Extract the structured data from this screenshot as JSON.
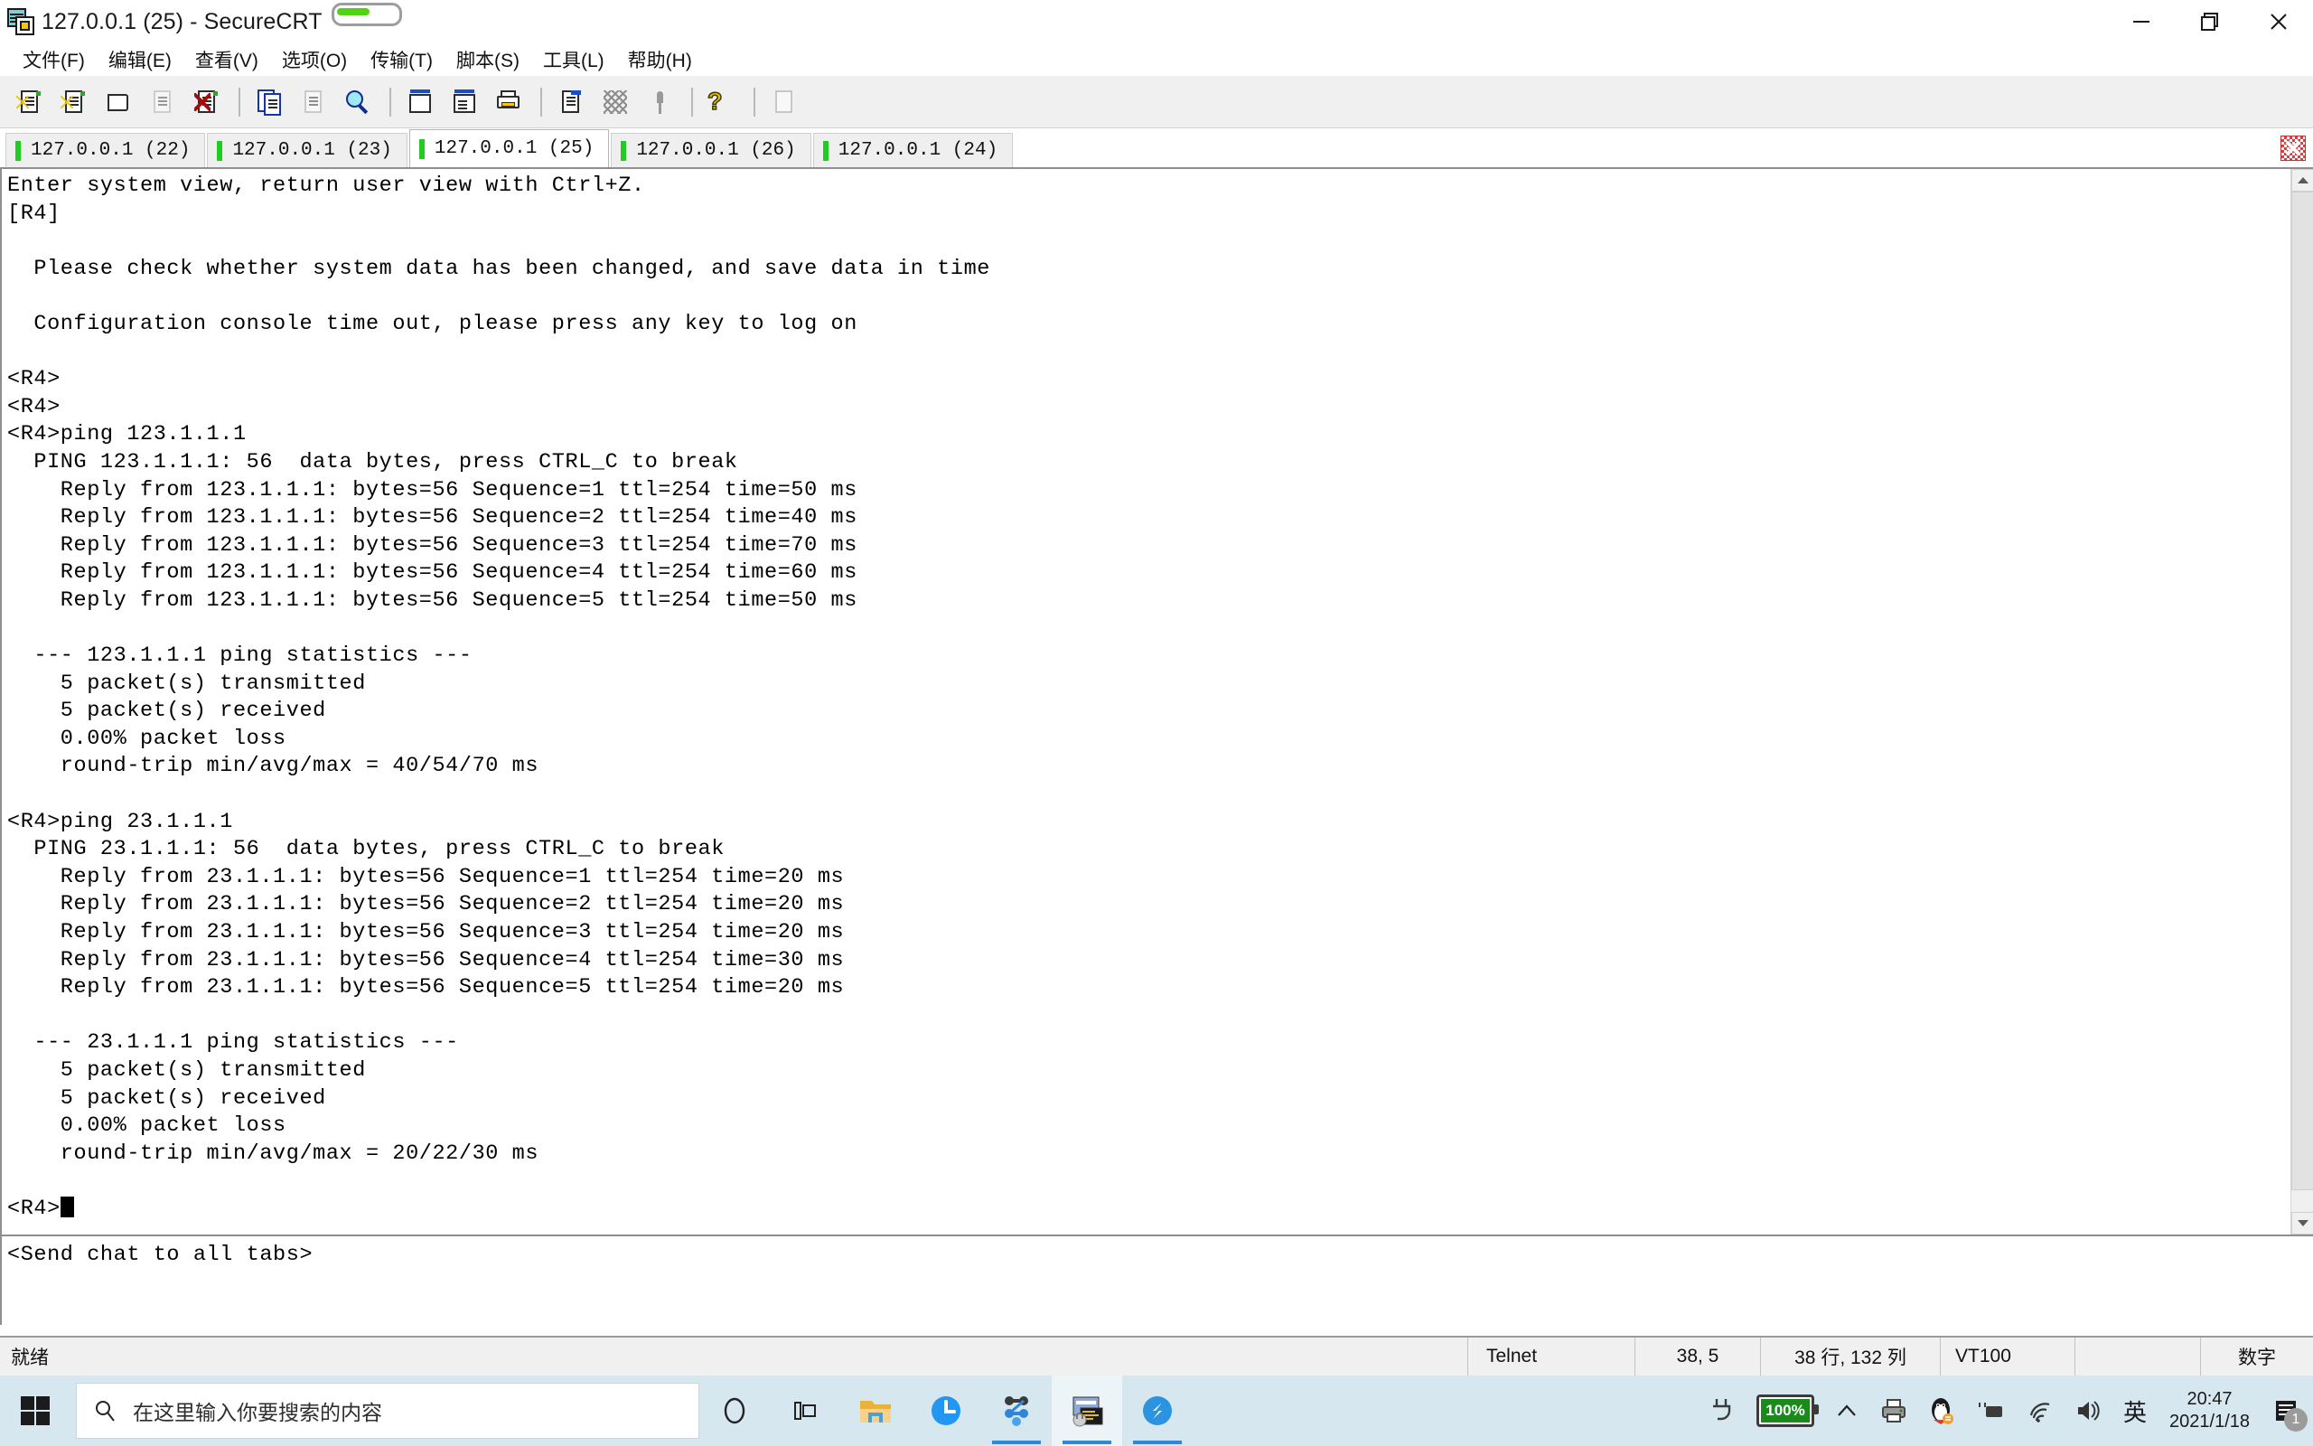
{
  "window": {
    "title": "127.0.0.1 (25) - SecureCRT",
    "icon": "securecrt-icon",
    "minimize_label": "—",
    "maximize_label": "restore",
    "close_label": "✕"
  },
  "menu": {
    "items": [
      {
        "label": "文件(F)",
        "name": "menu-file"
      },
      {
        "label": "编辑(E)",
        "name": "menu-edit"
      },
      {
        "label": "查看(V)",
        "name": "menu-view"
      },
      {
        "label": "选项(O)",
        "name": "menu-options"
      },
      {
        "label": "传输(T)",
        "name": "menu-transfer"
      },
      {
        "label": "脚本(S)",
        "name": "menu-script"
      },
      {
        "label": "工具(L)",
        "name": "menu-tools"
      },
      {
        "label": "帮助(H)",
        "name": "menu-help"
      }
    ]
  },
  "toolbar": {
    "buttons": [
      {
        "name": "new-session-icon"
      },
      {
        "name": "quick-connect-icon"
      },
      {
        "name": "open-session-icon"
      },
      {
        "name": "connect-sftp-icon"
      },
      {
        "name": "disconnect-icon"
      },
      {
        "name": "copy-icon"
      },
      {
        "name": "paste-icon"
      },
      {
        "name": "find-icon"
      },
      {
        "name": "print-screen-icon"
      },
      {
        "name": "log-session-icon"
      },
      {
        "name": "print-icon"
      },
      {
        "name": "session-options-icon"
      },
      {
        "name": "line-mode-icon"
      },
      {
        "name": "key-icon"
      },
      {
        "name": "help-icon"
      },
      {
        "name": "calculator-icon"
      }
    ]
  },
  "tabs": {
    "items": [
      {
        "label": "127.0.0.1 (22)",
        "active": false
      },
      {
        "label": "127.0.0.1 (23)",
        "active": false
      },
      {
        "label": "127.0.0.1 (25)",
        "active": true
      },
      {
        "label": "127.0.0.1 (26)",
        "active": false
      },
      {
        "label": "127.0.0.1 (24)",
        "active": false
      }
    ],
    "close_icon": "close-tab-icon"
  },
  "terminal": {
    "lines": [
      "Enter system view, return user view with Ctrl+Z.",
      "[R4]",
      "",
      "  Please check whether system data has been changed, and save data in time",
      "",
      "  Configuration console time out, please press any key to log on",
      "",
      "<R4>",
      "<R4>",
      "<R4>ping 123.1.1.1",
      "  PING 123.1.1.1: 56  data bytes, press CTRL_C to break",
      "    Reply from 123.1.1.1: bytes=56 Sequence=1 ttl=254 time=50 ms",
      "    Reply from 123.1.1.1: bytes=56 Sequence=2 ttl=254 time=40 ms",
      "    Reply from 123.1.1.1: bytes=56 Sequence=3 ttl=254 time=70 ms",
      "    Reply from 123.1.1.1: bytes=56 Sequence=4 ttl=254 time=60 ms",
      "    Reply from 123.1.1.1: bytes=56 Sequence=5 ttl=254 time=50 ms",
      "",
      "  --- 123.1.1.1 ping statistics ---",
      "    5 packet(s) transmitted",
      "    5 packet(s) received",
      "    0.00% packet loss",
      "    round-trip min/avg/max = 40/54/70 ms",
      "",
      "<R4>ping 23.1.1.1",
      "  PING 23.1.1.1: 56  data bytes, press CTRL_C to break",
      "    Reply from 23.1.1.1: bytes=56 Sequence=1 ttl=254 time=20 ms",
      "    Reply from 23.1.1.1: bytes=56 Sequence=2 ttl=254 time=20 ms",
      "    Reply from 23.1.1.1: bytes=56 Sequence=3 ttl=254 time=20 ms",
      "    Reply from 23.1.1.1: bytes=56 Sequence=4 ttl=254 time=30 ms",
      "    Reply from 23.1.1.1: bytes=56 Sequence=5 ttl=254 time=20 ms",
      "",
      "  --- 23.1.1.1 ping statistics ---",
      "    5 packet(s) transmitted",
      "    5 packet(s) received",
      "    0.00% packet loss",
      "    round-trip min/avg/max = 20/22/30 ms",
      "",
      "<R4>"
    ],
    "prompt_last": "<R4>"
  },
  "chat": {
    "placeholder_text": "<Send chat to all tabs>"
  },
  "statusbar": {
    "ready": "就绪",
    "protocol": "Telnet",
    "cursor_pos": "38,  5",
    "dimensions": "38 行, 132 列",
    "emulation": "VT100",
    "caps": "",
    "num": "数字"
  },
  "taskbar": {
    "start": "start-button",
    "search_placeholder": "在这里输入你要搜索的内容",
    "items": [
      {
        "name": "cortana-icon"
      },
      {
        "name": "task-view-icon"
      },
      {
        "name": "file-explorer-icon"
      },
      {
        "name": "clock-app-icon"
      },
      {
        "name": "ensp-icon"
      },
      {
        "name": "securecrt-taskbar-icon"
      },
      {
        "name": "sangfor-icon"
      }
    ],
    "tray": {
      "battery_percent": "100%",
      "time": "20:47",
      "date": "2021/1/18",
      "ime": "英",
      "notification_count": "1"
    }
  },
  "colors": {
    "accent_green": "#20cc20",
    "taskbar_bg": "#d7e7f0",
    "toolbar_bg": "#f0f0f0",
    "terminal_fg": "#000000",
    "terminal_bg": "#ffffff"
  }
}
